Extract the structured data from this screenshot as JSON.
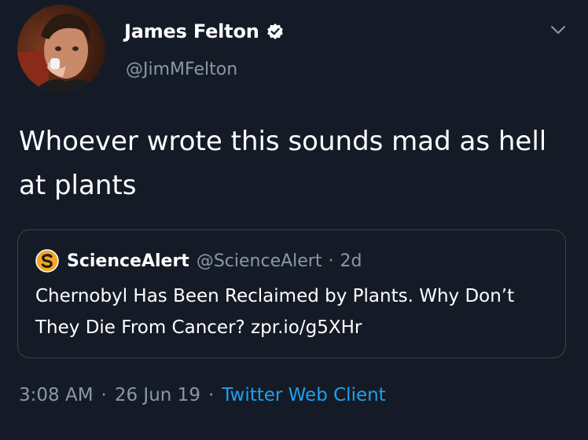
{
  "tweet": {
    "author": {
      "display_name": "James Felton",
      "handle": "@JimMFelton",
      "avatar_icon": "profile-photo",
      "verified_icon": "verified-badge-icon"
    },
    "menu_icon": "chevron-down-icon",
    "text": "Whoever wrote this sounds mad as hell at plants",
    "quote": {
      "logo_icon": "sciencealert-logo-icon",
      "author_name": "ScienceAlert",
      "author_handle": "@ScienceAlert",
      "separator": "·",
      "time": "2d",
      "text": "Chernobyl Has Been Reclaimed by Plants. Why Don’t They Die From Cancer?  zpr.io/g5XHr"
    },
    "meta": {
      "time": "3:08 AM",
      "separator": "·",
      "date": "26 Jun 19",
      "separator2": "·",
      "source": "Twitter Web Client"
    }
  },
  "colors": {
    "background": "#151b26",
    "text_primary": "#ffffff",
    "text_secondary": "#8899a6",
    "link": "#1da1f2",
    "border": "#38444d",
    "logo_orange": "#f5a623"
  }
}
